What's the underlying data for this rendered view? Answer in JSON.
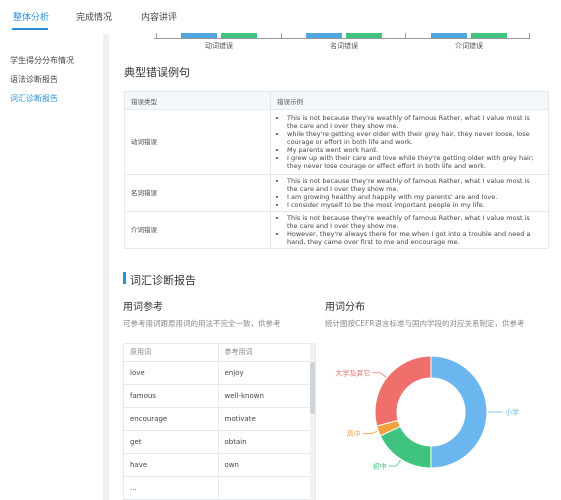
{
  "tabs": [
    "整体分析",
    "完成情况",
    "内容讲评"
  ],
  "sidebar": [
    "学生得分分布情况",
    "语法诊断报告",
    "词汇诊断报告"
  ],
  "axis_categories": [
    "动词错误",
    "名词错误",
    "介词错误"
  ],
  "colors": {
    "blue": "#4fa6e0",
    "green": "#3ec47e",
    "accent": "#2a8fd4",
    "red": "#ef6f6c",
    "orange": "#f0a23b",
    "sky": "#6bb6ee"
  },
  "error_section": {
    "title": "典型错误例句",
    "headers": [
      "错误类型",
      "错误示例"
    ],
    "rows": [
      {
        "type": "动词错误",
        "examples": [
          "This is not because they're weathly of famous Rather, what I value most is the care and I over they show me.",
          "while they're getting ever older with their grey hair, they never loose, lose courage or effort in both life and work.",
          "My parents went work hard.",
          "I grew up with their care and love while they're getting older with grey hair; they never lose courage or effect effort in both life and work."
        ]
      },
      {
        "type": "名词错误",
        "examples": [
          "This is not because they're weathly of famous Rather, what I value most is the care and I over they show me.",
          "I am growing healthy and happily with my parents' are and love.",
          "I consider myself to be the most important people in my life."
        ]
      },
      {
        "type": "介词错误",
        "examples": [
          "This is not because they're weathly of famous Rather, what I value most is the care and I over they show me.",
          "However, they're always there for me when I got into a trouble and need a hand, they came over first to me and encourage me."
        ]
      }
    ]
  },
  "vocab": {
    "title": "词汇诊断报告",
    "ref_title": "用词参考",
    "ref_note": "可参考用词跟原用词的用法不完全一致，供参考",
    "dist_title": "用词分布",
    "dist_note": "统计图按CEFR语言标准与国内学段的对应关系制定，供参考",
    "headers": [
      "原用词",
      "参考用词"
    ],
    "rows": [
      [
        "love",
        "enjoy"
      ],
      [
        "famous",
        "well-known"
      ],
      [
        "encourage",
        "motivate"
      ],
      [
        "get",
        "obtain"
      ],
      [
        "have",
        "own"
      ],
      [
        "...",
        ""
      ]
    ]
  },
  "chart_data": {
    "type": "pie",
    "categories": [
      "小学",
      "初中",
      "高中",
      "大学及其它"
    ],
    "values": [
      50,
      18,
      3,
      29
    ],
    "colors": [
      "#6bb6ee",
      "#3ec47e",
      "#f0a23b",
      "#ef6f6c"
    ]
  }
}
